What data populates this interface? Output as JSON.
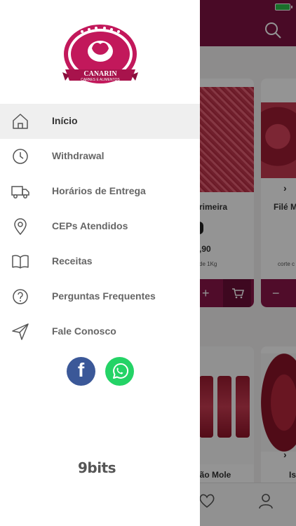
{
  "drawer": {
    "logo": {
      "name": "CANARIN",
      "subtitle": "CARNES E ALIMENTOS"
    },
    "items": [
      {
        "label": "Início",
        "icon": "home-icon",
        "active": true
      },
      {
        "label": "Withdrawal",
        "icon": "clock-icon"
      },
      {
        "label": "Horários de Entrega",
        "icon": "truck-icon"
      },
      {
        "label": "CEPs Atendidos",
        "icon": "location-pin-icon"
      },
      {
        "label": "Receitas",
        "icon": "book-icon"
      },
      {
        "label": "Perguntas Frequentes",
        "icon": "question-circle-icon"
      },
      {
        "label": "Fale Conosco",
        "icon": "send-icon"
      }
    ],
    "social": [
      {
        "name": "facebook",
        "glyph": "f",
        "color": "#3b5898"
      },
      {
        "name": "whatsapp",
        "color": "#24d366"
      }
    ],
    "brand": "9bits"
  },
  "background": {
    "cards": [
      {
        "name": "rimeira",
        "price": ",90",
        "subtitle": "de 1Kg"
      },
      {
        "name": "Filé M",
        "subtitle": "corte c"
      },
      {
        "name": "xão Mole"
      },
      {
        "name": "Is"
      }
    ],
    "qty_minus": "−",
    "qty_plus": "+"
  },
  "colors": {
    "brand": "#7e1242",
    "accent": "#8a1649",
    "active_bg": "#efefef"
  }
}
